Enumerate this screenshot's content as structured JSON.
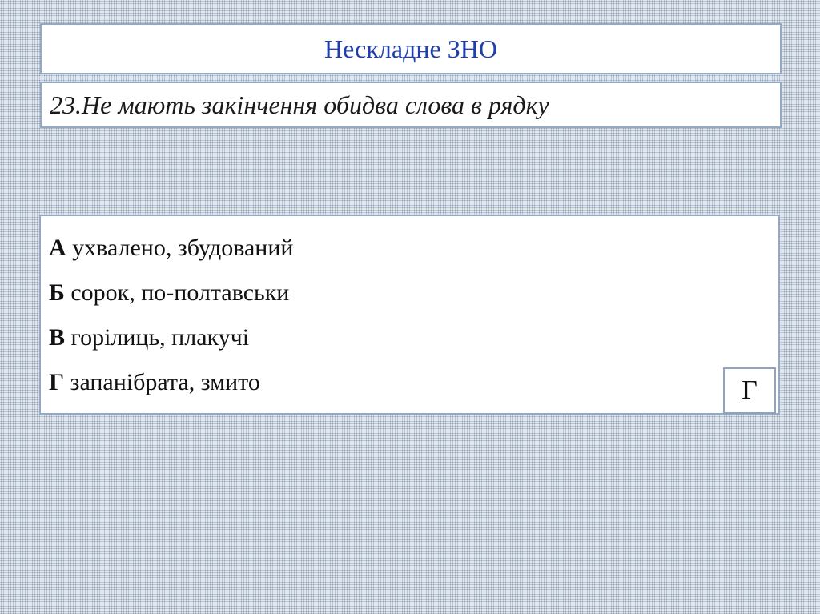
{
  "header": {
    "title": "Нескладне ЗНО"
  },
  "question": {
    "text": "23.Не мають закінчення обидва слова в рядку"
  },
  "options": [
    {
      "letter": "А",
      "text": " ухвалено, збудований"
    },
    {
      "letter": "Б",
      "text": " сорок, по-полтавськи"
    },
    {
      "letter": "В",
      "text": " горілиць, плакучі"
    },
    {
      "letter": "Г",
      "text": " запанібрата, змито"
    }
  ],
  "answer": {
    "value": "Г"
  },
  "colors": {
    "title_text": "#1f3fae",
    "box_border": "#93a9c6",
    "background": "#c9d3df"
  }
}
